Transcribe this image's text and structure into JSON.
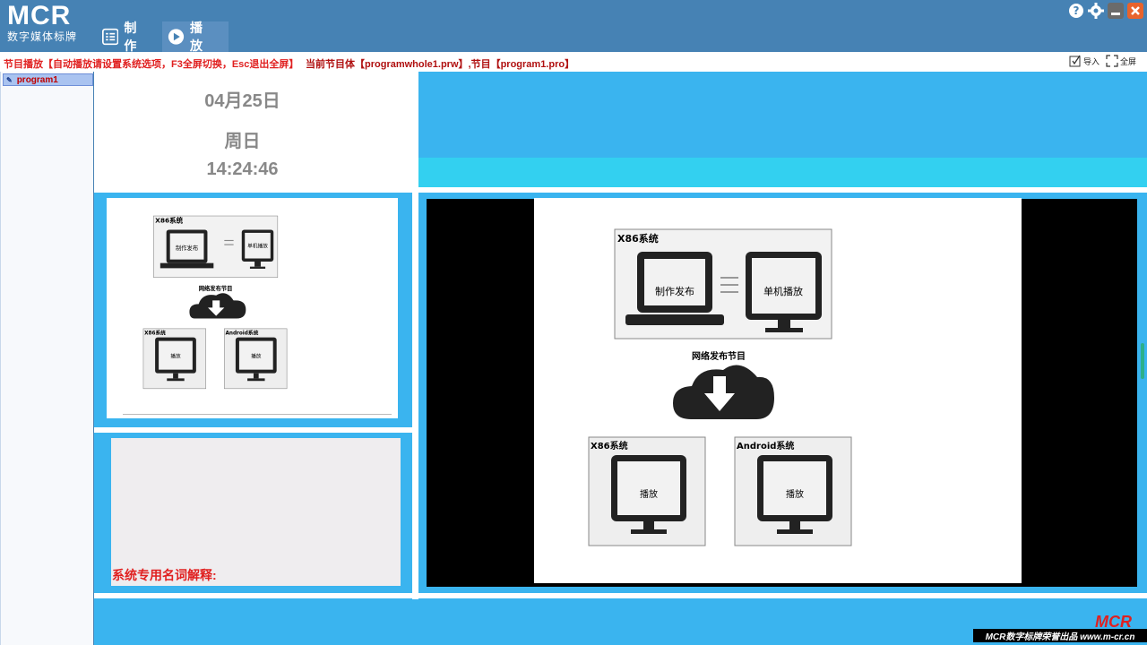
{
  "titlebar": {
    "logo_big": "MCR",
    "logo_small": "数字媒体标牌",
    "make_label": "制 作",
    "play_label": "播 放"
  },
  "statusbar": {
    "left_text": "节目播放【自动播放请设置系统选项，F3全屏切换，Esc退出全屏】",
    "mid_text": "当前节目体【programwhole1.prw】,节目【program1.pro】",
    "import_label": "导入",
    "fullscreen_label": "全屏"
  },
  "program_list": {
    "items": [
      {
        "label": "program1"
      }
    ]
  },
  "clock": {
    "date": "04月25日",
    "weekday": "周日",
    "time": "14:24:46"
  },
  "term_panel": {
    "label": "系统专用名词解释:"
  },
  "slide": {
    "x86_system": "X86系统",
    "make_publish": "制作发布",
    "standalone_play": "单机播放",
    "network_publish": "网络发布节目",
    "x86_system_2": "X86系统",
    "android_system": "Android系统",
    "play": "播放"
  },
  "footer": {
    "logo": "MCR",
    "credit": "MCR数字标牌荣誉出品 www.m-cr.cn"
  },
  "colors": {
    "titlebar": "#4682b4",
    "stage_blue": "#3ab4ef",
    "cyan_band": "#33d0f0",
    "status_red": "#e02020"
  }
}
